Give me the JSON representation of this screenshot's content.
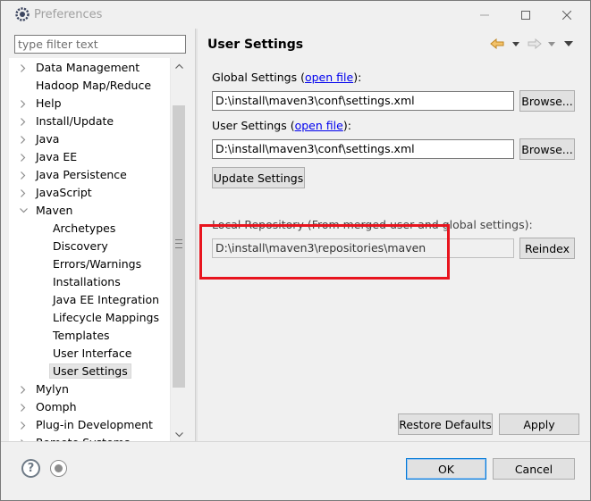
{
  "window": {
    "title": "Preferences"
  },
  "left": {
    "filter_placeholder": "type filter text",
    "tree": [
      {
        "label": "Data Management",
        "level": 0,
        "toggle": "collapsed"
      },
      {
        "label": "Hadoop Map/Reduce",
        "level": 0,
        "toggle": "none"
      },
      {
        "label": "Help",
        "level": 0,
        "toggle": "collapsed"
      },
      {
        "label": "Install/Update",
        "level": 0,
        "toggle": "collapsed"
      },
      {
        "label": "Java",
        "level": 0,
        "toggle": "collapsed"
      },
      {
        "label": "Java EE",
        "level": 0,
        "toggle": "collapsed"
      },
      {
        "label": "Java Persistence",
        "level": 0,
        "toggle": "collapsed"
      },
      {
        "label": "JavaScript",
        "level": 0,
        "toggle": "collapsed"
      },
      {
        "label": "Maven",
        "level": 0,
        "toggle": "expanded"
      },
      {
        "label": "Archetypes",
        "level": 1,
        "toggle": "none"
      },
      {
        "label": "Discovery",
        "level": 1,
        "toggle": "none"
      },
      {
        "label": "Errors/Warnings",
        "level": 1,
        "toggle": "none"
      },
      {
        "label": "Installations",
        "level": 1,
        "toggle": "none"
      },
      {
        "label": "Java EE Integration",
        "level": 1,
        "toggle": "none"
      },
      {
        "label": "Lifecycle Mappings",
        "level": 1,
        "toggle": "none"
      },
      {
        "label": "Templates",
        "level": 1,
        "toggle": "none"
      },
      {
        "label": "User Interface",
        "level": 1,
        "toggle": "none"
      },
      {
        "label": "User Settings",
        "level": 1,
        "toggle": "none",
        "selected": true
      },
      {
        "label": "Mylyn",
        "level": 0,
        "toggle": "collapsed"
      },
      {
        "label": "Oomph",
        "level": 0,
        "toggle": "collapsed"
      },
      {
        "label": "Plug-in Development",
        "level": 0,
        "toggle": "collapsed"
      },
      {
        "label": "Remote Systems",
        "level": 0,
        "toggle": "collapsed"
      }
    ]
  },
  "right": {
    "title": "User Settings",
    "global_settings": {
      "label": "Global Settings (",
      "link": "open file",
      "suffix": "):",
      "value": "D:\\install\\maven3\\conf\\settings.xml",
      "browse": "Browse..."
    },
    "user_settings": {
      "label": "User Settings (",
      "link": "open file",
      "suffix": "):",
      "value": "D:\\install\\maven3\\conf\\settings.xml",
      "browse": "Browse..."
    },
    "update_button": "Update Settings",
    "local_repo": {
      "label": "Local Repository (From merged user and global settings):",
      "value": "D:\\install\\maven3\\repositories\\maven",
      "reindex": "Reindex"
    },
    "restore_defaults": "Restore Defaults",
    "apply": "Apply"
  },
  "footer": {
    "ok": "OK",
    "cancel": "Cancel"
  },
  "colors": {
    "highlight": "#e8141e",
    "link": "#0000ee",
    "default_button_border": "#0078d7"
  }
}
